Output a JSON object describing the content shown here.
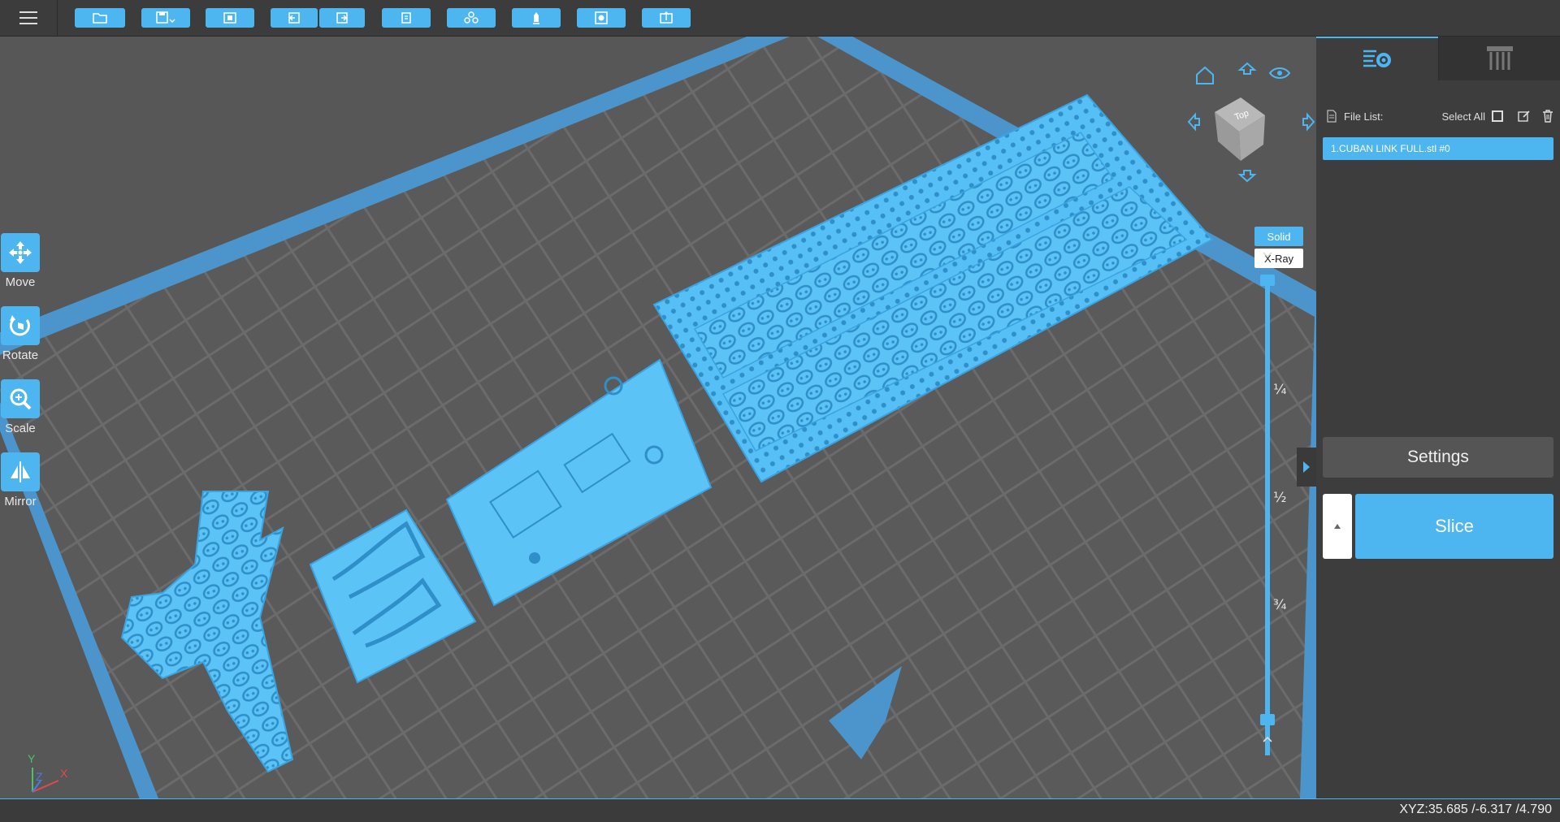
{
  "colors": {
    "accent": "#4db5f0",
    "plate": "#5a5a5a",
    "grid": "#6c6c6c",
    "background": "#575757"
  },
  "toolbar": {
    "icons": [
      "menu-icon",
      "open-folder-icon",
      "save-icon",
      "import-icon",
      "undo-icon",
      "redo-icon",
      "copy-icon",
      "arrange-icon",
      "support-icon",
      "hollow-icon",
      "export-icon"
    ]
  },
  "tools": {
    "move": "Move",
    "rotate": "Rotate",
    "scale": "Scale",
    "mirror": "Mirror"
  },
  "viewcube": {
    "face": "Top"
  },
  "view_modes": {
    "solid": "Solid",
    "xray": "X-Ray"
  },
  "slider": {
    "q1": "¼",
    "q2": "½",
    "q3": "¾"
  },
  "axes": {
    "x": "X",
    "y": "Y",
    "z": "Z"
  },
  "panel": {
    "file_list_label": "File List:",
    "select_all_label": "Select All",
    "files": [
      "1.CUBAN LINK FULL.stl #0"
    ],
    "settings_label": "Settings",
    "slice_label": "Slice"
  },
  "status": {
    "coordinates": "XYZ:35.685 /-6.317 /4.790"
  }
}
